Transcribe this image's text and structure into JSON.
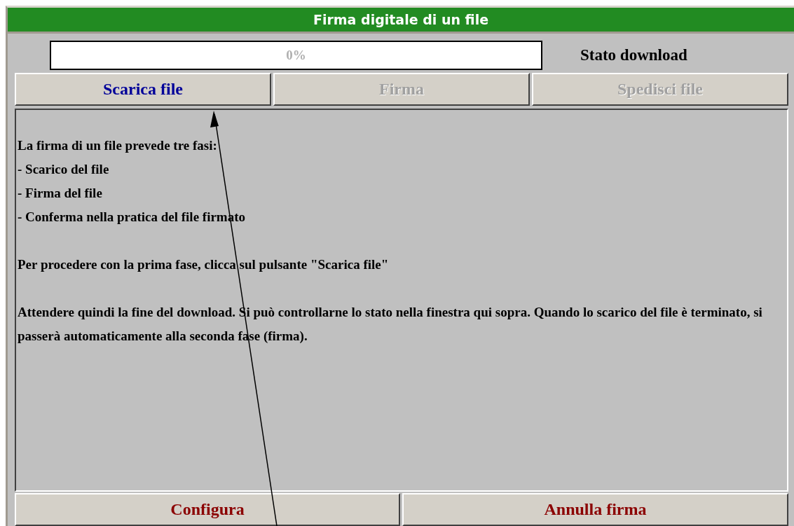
{
  "window": {
    "title": "Firma digitale di un file"
  },
  "download": {
    "level": 0,
    "reading": "0%",
    "label": "Stato download"
  },
  "steps": [
    {
      "label": "Scarica file",
      "disabled": false
    },
    {
      "label": "Firma",
      "disabled": true
    },
    {
      "label": "Spedisci file",
      "disabled": true
    }
  ],
  "instructions": [
    [
      "La firma di un file prevede tre fasi:",
      "- Scarico del file",
      "- Firma del file",
      "- Conferma nella pratica del file firmato"
    ],
    [
      "Per procedere con la prima fase, clicca sul pulsante \"Scarica file\""
    ],
    [
      "Attendere quindi la fine del download. Si può controllarne lo stato nella finestra qui sopra. Quando lo scarico del file è terminato, si passerà automaticamente alla seconda fase (firma)."
    ]
  ],
  "buttons": [
    {
      "label": "Configura"
    },
    {
      "label": "Annulla firma"
    }
  ]
}
